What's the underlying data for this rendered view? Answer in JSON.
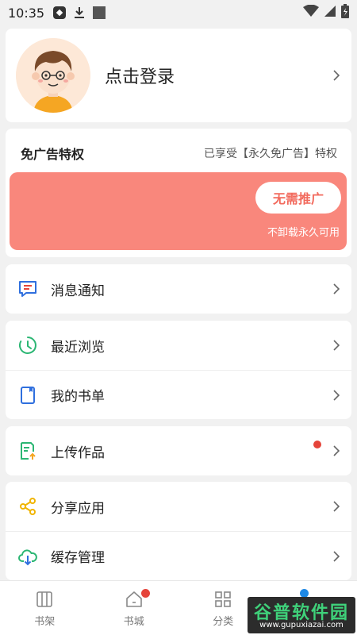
{
  "status_bar": {
    "time": "10:35"
  },
  "profile": {
    "login_label": "点击登录"
  },
  "privilege": {
    "title": "免广告特权",
    "status": "已享受【永久免广告】特权",
    "button": "无需推广",
    "note": "不卸载永久可用"
  },
  "menu": {
    "messages": "消息通知",
    "recent": "最近浏览",
    "booklist": "我的书单",
    "upload": "上传作品",
    "share": "分享应用",
    "cache": "缓存管理"
  },
  "bottom_nav": {
    "items": [
      {
        "label": "书架"
      },
      {
        "label": "书城"
      },
      {
        "label": "分类"
      },
      {
        "label": ""
      }
    ]
  },
  "watermark": {
    "title": "谷普软件园",
    "url": "www.gupuxiazai.com"
  },
  "colors": {
    "promo": "#f9877c",
    "badge": "#e5443a",
    "accent_blue": "#1e88e5",
    "watermark_green": "#3fd17a"
  }
}
